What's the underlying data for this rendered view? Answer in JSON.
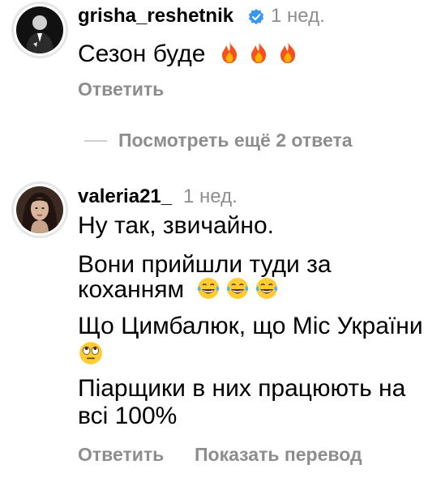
{
  "comments": [
    {
      "username": "grisha_reshetnik",
      "verified": true,
      "time": "1 нед.",
      "lines": [
        "Сезон буде"
      ],
      "reply_label": "Ответить"
    },
    {
      "username": "valeria21_",
      "verified": false,
      "time": "1 нед.",
      "lines": [
        "Ну так, звичайно.",
        "Вони прийшли туди за",
        "коханням",
        "Що Цимбалюк, що Міс України",
        "Піарщики в них працюють на",
        "всі 100%"
      ],
      "reply_label": "Ответить",
      "translate_label": "Показать перевод"
    }
  ],
  "view_more_replies": "Посмотреть ещё 2 ответа",
  "emojis": {
    "fire": "fire-emoji",
    "laugh": "tears-of-joy-emoji",
    "eye_roll": "eye-roll-emoji"
  },
  "colors": {
    "text": "#000000",
    "muted": "#8e8e8e",
    "verified": "#3897f0",
    "ring": "#e6e6e6"
  }
}
